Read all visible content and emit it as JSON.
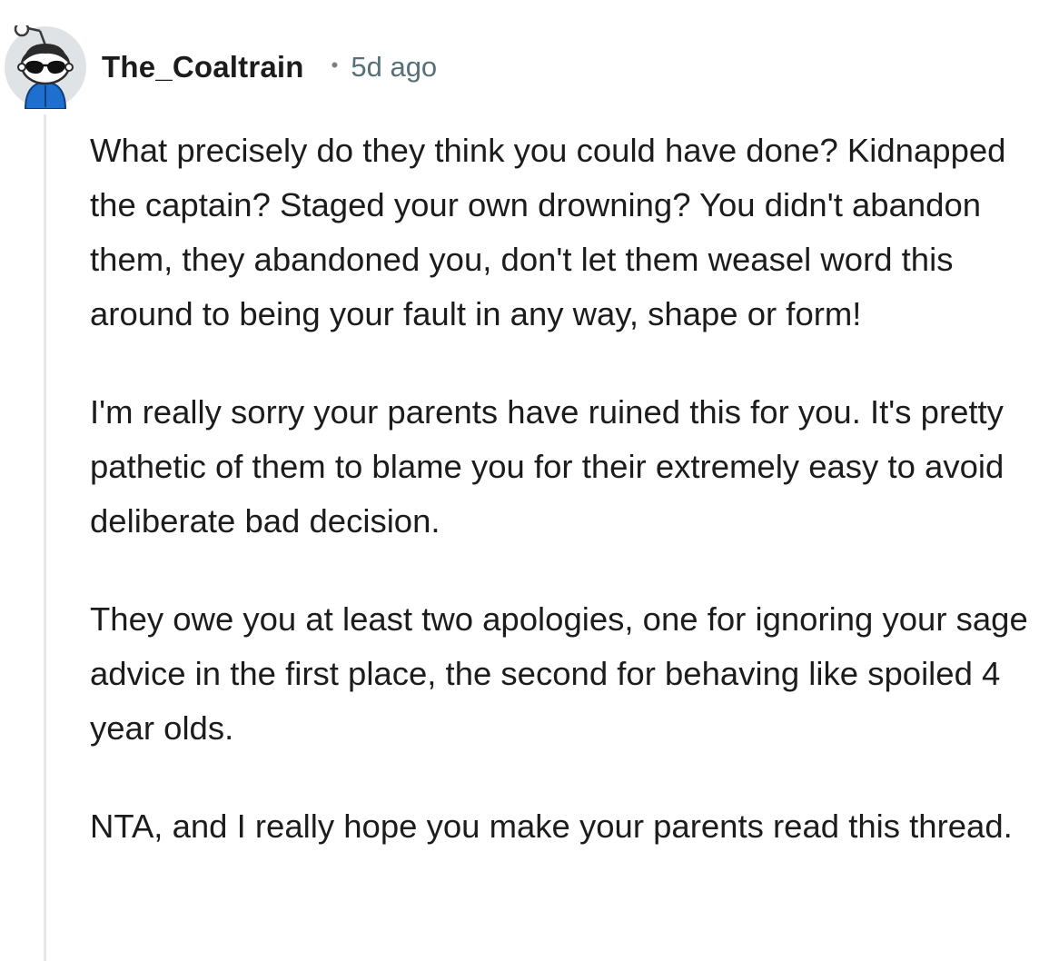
{
  "comment": {
    "author": "The_Coaltrain",
    "separator": "•",
    "time_ago": "5d ago",
    "paragraphs": [
      "What precisely do they think you could have done? Kidnapped the captain? Staged your own drowning? You didn't abandon them, they abandoned you, don't let them weasel word this around to being your fault in any way, shape or form!",
      "I'm really sorry your parents have ruined this for you. It's pretty pathetic of them to blame you for their extremely easy to avoid deliberate bad decision.",
      "They owe you at least two apologies, one for ignoring your sage advice in the first place, the second for behaving like spoiled 4 year olds.",
      "NTA, and I really hope you make your parents read this thread."
    ]
  },
  "colors": {
    "avatar_background": "#dfe3e6",
    "avatar_shirt": "#1f6fd1",
    "thread_line": "#e6e8ea",
    "timestamp": "#576f76"
  },
  "icons": {
    "avatar": "snoo-avatar-sunglasses-icon"
  }
}
